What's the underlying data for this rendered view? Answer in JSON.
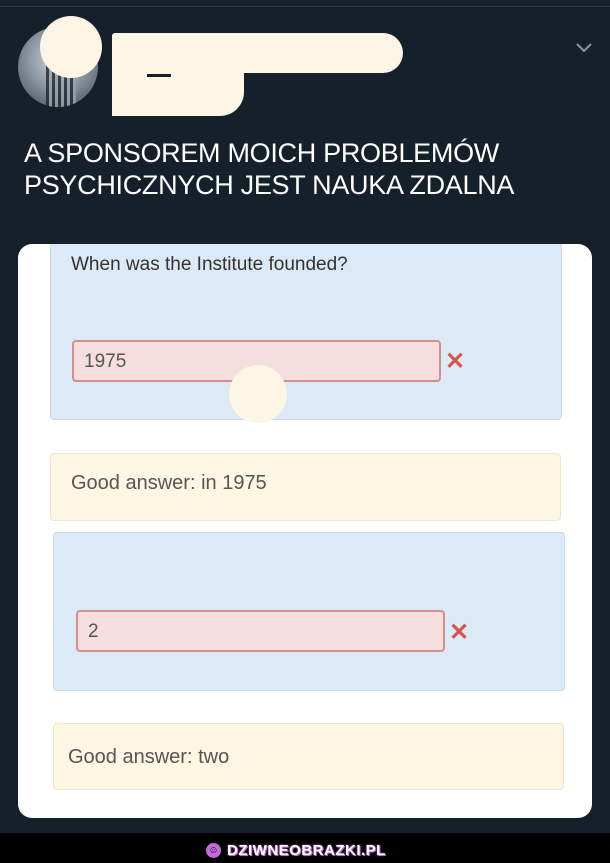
{
  "tweet": {
    "text": "A SPONSOREM MOICH PROBLEMÓW PSYCHICZNYCH JEST NAUKA ZDALNA",
    "menu_icon": "chevron-down-icon"
  },
  "quiz": {
    "question1": {
      "question": "When was the Institute founded?",
      "answer": "1975",
      "status_icon": "wrong-x-icon",
      "feedback": "Good answer: in 1975"
    },
    "question2": {
      "answer": "2",
      "status_icon": "wrong-x-icon",
      "feedback": "Good answer: two"
    }
  },
  "footer": {
    "site": "DZIWNEOBRAZKI.PL",
    "accent": "#c06bd6"
  },
  "colors": {
    "background": "#15202b",
    "question_box": "#dbeaf6",
    "wrong_input": "#f6dede",
    "wrong_mark": "#d9534f",
    "feedback_box": "#fdf6e3",
    "redaction": "#fdf5e6"
  }
}
